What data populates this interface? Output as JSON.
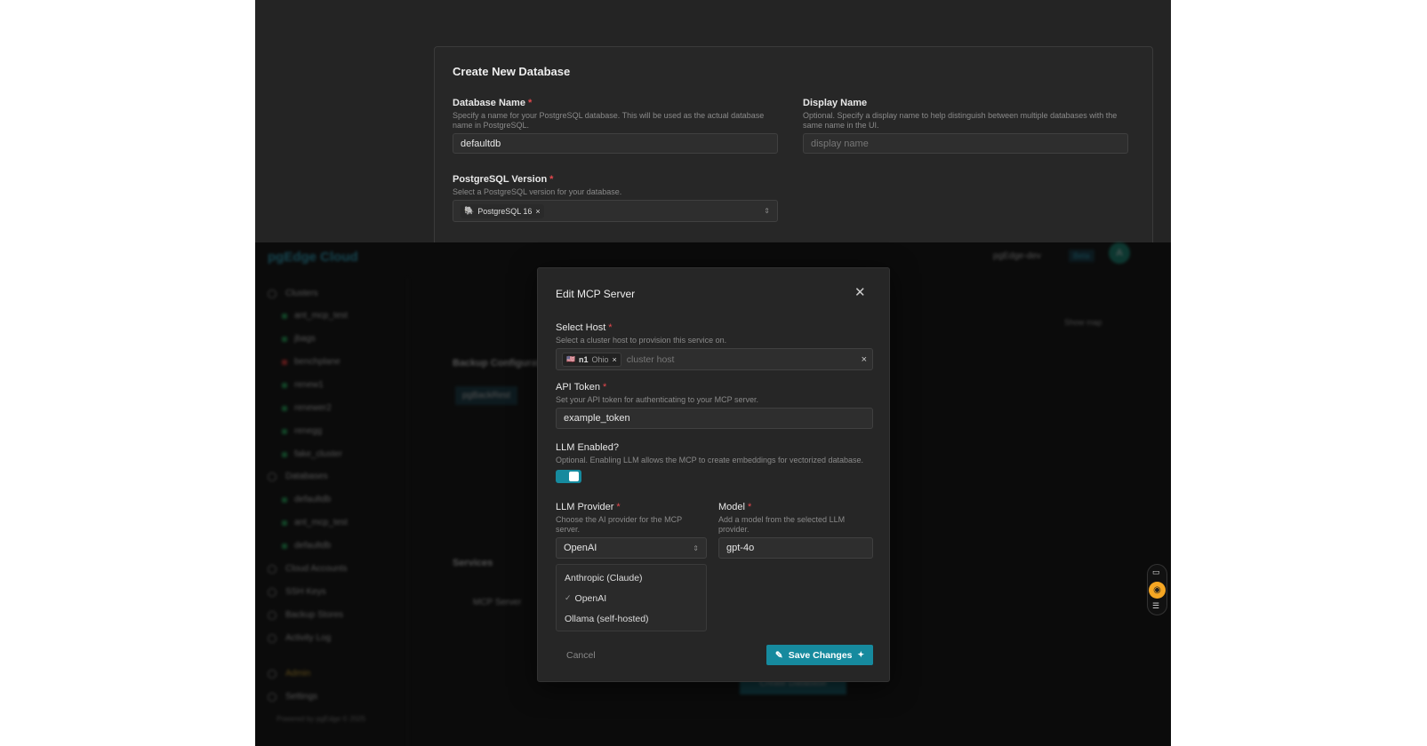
{
  "create_db": {
    "title": "Create New Database",
    "db_name": {
      "label": "Database Name",
      "required": "*",
      "desc": "Specify a name for your PostgreSQL database. This will be used as the actual database name in PostgreSQL.",
      "value": "defaultdb"
    },
    "display_name": {
      "label": "Display Name",
      "desc": "Optional. Specify a display name to help distinguish between multiple databases with the same name in the UI.",
      "placeholder": "display name"
    },
    "pg_version": {
      "label": "PostgreSQL Version",
      "required": "*",
      "desc": "Select a PostgreSQL version for your database.",
      "chip": "PostgreSQL 16"
    }
  },
  "app": {
    "brand": "pgEdge Cloud",
    "header_user": "pgEdge-dev",
    "header_badge": "Beta",
    "avatar": "A",
    "sidebar": {
      "clusters_label": "Clusters",
      "clusters": [
        "ant_mcp_test",
        "jbags",
        "benchplane",
        "renew1",
        "renewer2",
        "renegg",
        "fake_cluster"
      ],
      "databases_label": "Databases",
      "databases": [
        "defaultdb",
        "ant_mcp_test",
        "defaultdb"
      ],
      "nav": [
        "Cloud Accounts",
        "SSH Keys",
        "Backup Stores",
        "Activity Log"
      ],
      "admin": "Admin",
      "settings": "Settings",
      "footer": "Powered by pgEdge © 2025"
    },
    "main": {
      "backup_title": "Backup Configuration",
      "backup_chip": "pgBackRest",
      "services_title": "Services",
      "service_item": "MCP Server",
      "show_map": "Show map",
      "create_button": "Create Database"
    }
  },
  "modal": {
    "title": "Edit MCP Server",
    "host": {
      "label": "Select Host",
      "required": "*",
      "desc": "Select a cluster host to provision this service on.",
      "chip_name": "n1",
      "chip_region": "Ohio",
      "placeholder": "cluster host"
    },
    "token": {
      "label": "API Token",
      "required": "*",
      "desc": "Set your API token for authenticating to your MCP server.",
      "value": "example_token"
    },
    "llm": {
      "label": "LLM Enabled?",
      "desc": "Optional. Enabling LLM allows the MCP to create embeddings for vectorized database.",
      "enabled": true
    },
    "provider": {
      "label": "LLM Provider",
      "required": "*",
      "desc": "Choose the AI provider for the MCP server.",
      "value": "OpenAI",
      "options": [
        "Anthropic (Claude)",
        "OpenAI",
        "Ollama (self-hosted)"
      ],
      "selected": "OpenAI"
    },
    "model": {
      "label": "Model",
      "required": "*",
      "desc": "Add a model from the selected LLM provider.",
      "value": "gpt-4o"
    },
    "cancel": "Cancel",
    "save": "Save Changes"
  },
  "colors": {
    "accent": "#168a9e",
    "required": "#e5484d",
    "widget": "#f5a623"
  }
}
